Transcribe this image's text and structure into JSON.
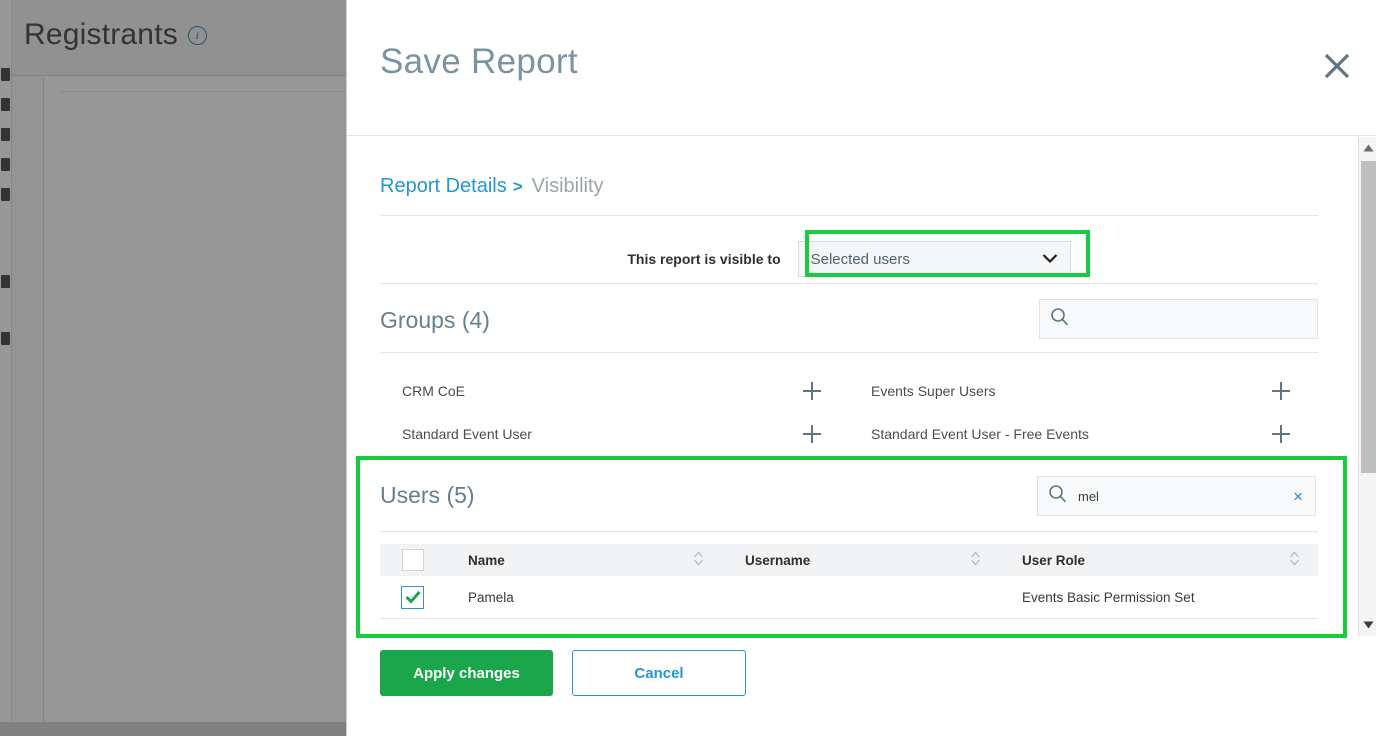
{
  "background": {
    "page_title": "Registrants",
    "info_icon": "info-icon"
  },
  "modal": {
    "title": "Save Report",
    "close_icon": "close-icon",
    "breadcrumb": {
      "parent": "Report Details",
      "separator": ">",
      "current": "Visibility"
    },
    "visibility": {
      "label": "This report is visible to",
      "selected_value": "Selected users",
      "caret_icon": "chevron-down-icon"
    },
    "groups": {
      "heading": "Groups (4)",
      "search_placeholder": "",
      "search_value": "",
      "search_icon": "search-icon",
      "items": [
        {
          "name": "CRM CoE",
          "add_icon": "plus-icon"
        },
        {
          "name": "Events Super Users",
          "add_icon": "plus-icon"
        },
        {
          "name": "Standard Event User",
          "add_icon": "plus-icon"
        },
        {
          "name": "Standard Event User - Free Events",
          "add_icon": "plus-icon"
        }
      ]
    },
    "users": {
      "heading": "Users (5)",
      "search_value": "mel",
      "search_placeholder": "",
      "search_icon": "search-icon",
      "clear_icon": "×",
      "columns": [
        "Name",
        "Username",
        "User Role"
      ],
      "sort_icon": "sort-icon",
      "rows": [
        {
          "checked": true,
          "name": "Pamela",
          "username": "",
          "user_role": "Events Basic Permission Set"
        }
      ]
    },
    "footer": {
      "apply_label": "Apply changes",
      "cancel_label": "Cancel"
    },
    "scrollbar": {
      "up_icon": "triangle-up-icon",
      "down_icon": "triangle-down-icon"
    }
  },
  "annotations": {
    "color": "#17cc3f",
    "regions": [
      "visibility-select",
      "users-section"
    ]
  },
  "colors": {
    "accent_green": "#1ca64c",
    "link_blue": "#2596d8",
    "title_slate": "#7b94a3",
    "heading_slate": "#65808f"
  }
}
